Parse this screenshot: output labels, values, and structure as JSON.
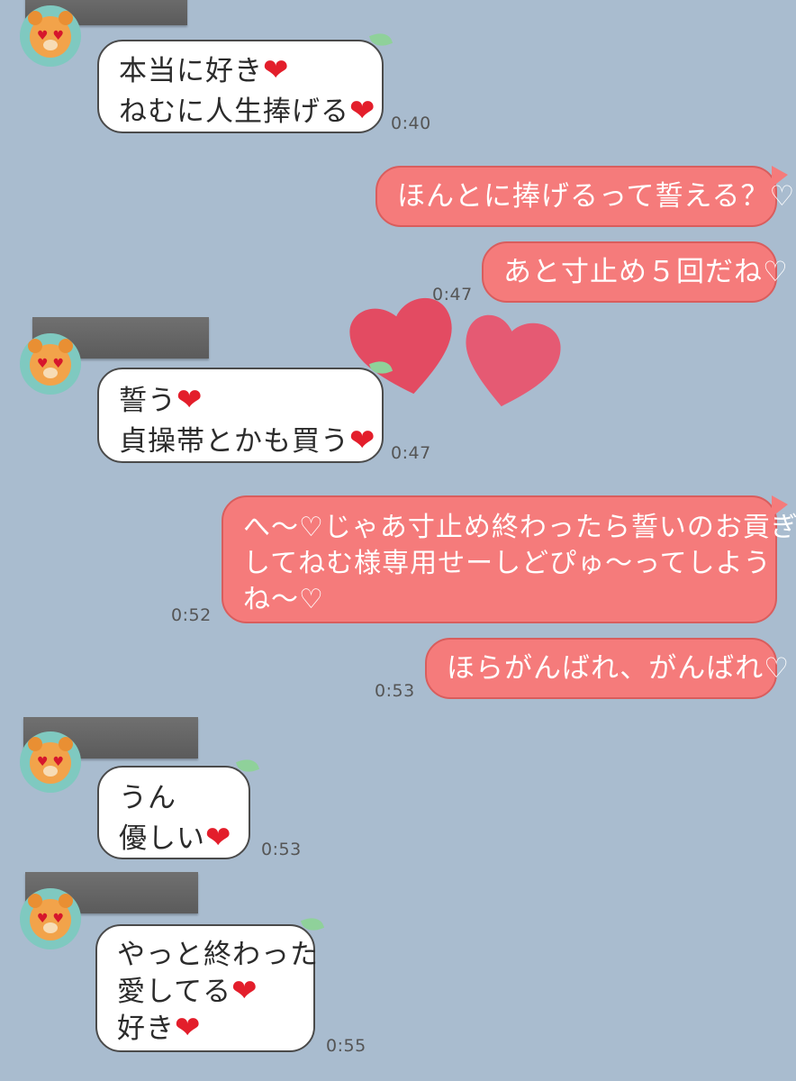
{
  "conversation": {
    "groups": [
      {
        "sender": "other",
        "messages": [
          {
            "lines": [
              "本当に好き",
              "ねむに人生捧げる"
            ],
            "hearts": [
              true,
              true
            ],
            "time": "0:40"
          }
        ]
      },
      {
        "sender": "me",
        "messages": [
          {
            "lines": [
              "ほんとに捧げるって誓える？♡"
            ]
          },
          {
            "lines": [
              "あと寸止め５回だね♡"
            ],
            "time": "0:47"
          }
        ]
      },
      {
        "sender": "other",
        "messages": [
          {
            "lines": [
              "誓う",
              "貞操帯とかも買う"
            ],
            "hearts": [
              true,
              true
            ],
            "time": "0:47"
          }
        ]
      },
      {
        "sender": "me",
        "messages": [
          {
            "lines": [
              "へ〜♡じゃあ寸止め終わったら誓いのお貢ぎ",
              "してねむ様専用せーしどぴゅ〜ってしよう",
              "ね〜♡"
            ],
            "time": "0:52"
          },
          {
            "lines": [
              "ほらがんばれ、がんばれ♡"
            ],
            "time": "0:53"
          }
        ]
      },
      {
        "sender": "other",
        "messages": [
          {
            "lines": [
              "うん",
              "優しい"
            ],
            "hearts": [
              false,
              true
            ],
            "time": "0:53"
          }
        ]
      },
      {
        "sender": "other",
        "messages": [
          {
            "lines": [
              "やっと終わった",
              "愛してる",
              "好き"
            ],
            "hearts": [
              false,
              true,
              true
            ],
            "time": "0:55"
          }
        ]
      }
    ]
  },
  "heart_glyph": "❤",
  "avatar_eye_glyph": "♥",
  "colors": {
    "background": "#a9bccf",
    "outgoing_bubble": "#f57b7b",
    "incoming_bubble": "#ffffff",
    "heart_sticker_left": "#e34b62",
    "heart_sticker_right": "#e55a73"
  },
  "icons": [
    "bear-avatar-icon",
    "leaf-icon",
    "heart-emoji-icon",
    "heart-sticker-icon"
  ]
}
